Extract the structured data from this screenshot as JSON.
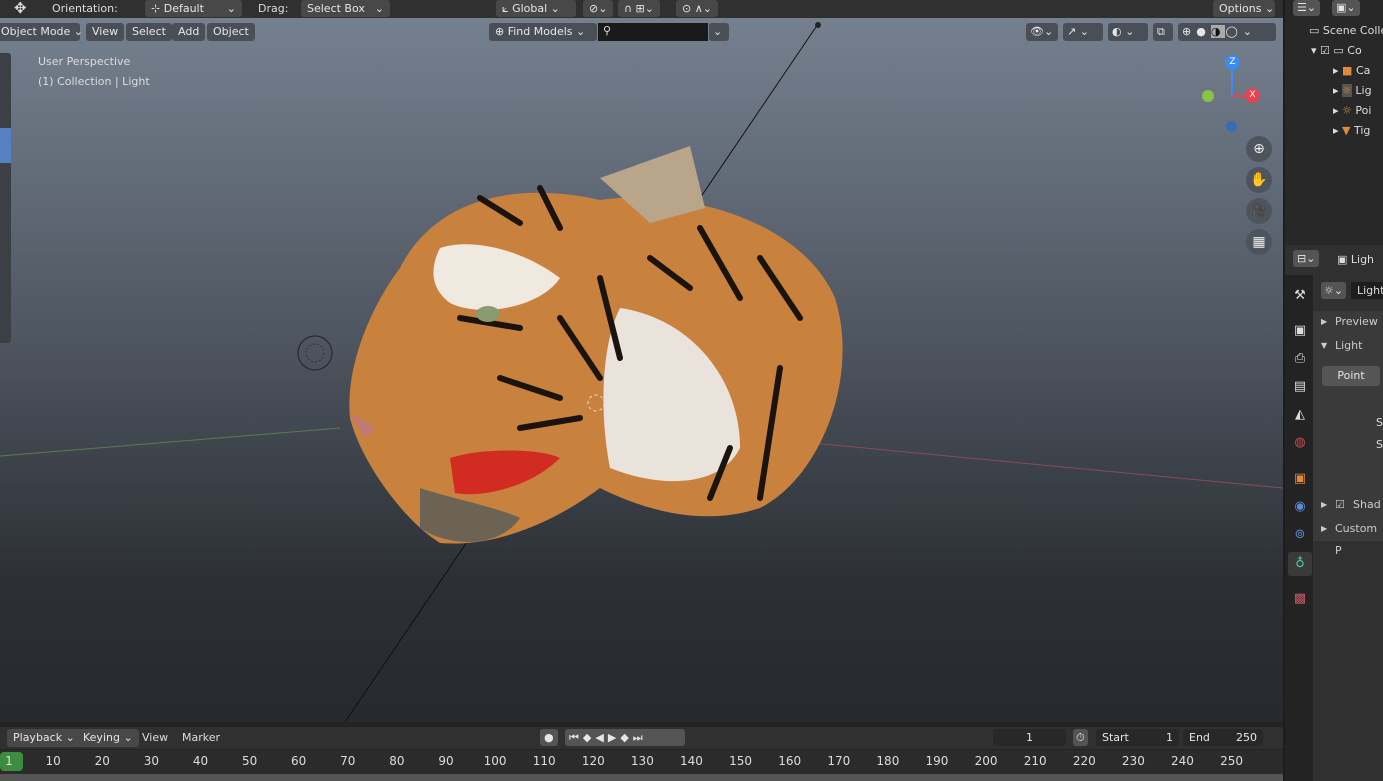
{
  "header": {
    "orientation_label": "Orientation:",
    "orientation_value": "Default",
    "drag_label": "Drag:",
    "drag_value": "Select Box",
    "transform_space": "Global",
    "options": "Options"
  },
  "viewport_header": {
    "mode": "Object Mode",
    "menus": [
      "View",
      "Select",
      "Add",
      "Object"
    ],
    "find_models": "Find Models",
    "search_placeholder": ""
  },
  "viewport": {
    "perspective": "User Perspective",
    "collection": "(1) Collection | Light",
    "gizmo": {
      "z": "Z",
      "x": "X"
    }
  },
  "outliner": {
    "items": [
      {
        "label": "Scene Colle"
      },
      {
        "label": "Co"
      },
      {
        "label": "Ca"
      },
      {
        "label": "Lig"
      },
      {
        "label": "Poi"
      },
      {
        "label": "Tig"
      }
    ]
  },
  "properties": {
    "header": "Ligh",
    "datablock": "Light",
    "panels": {
      "preview": "Preview",
      "light": "Light",
      "type": "Point",
      "s1": "S",
      "s2": "S",
      "shadow": "Shad",
      "custom": "Custom P"
    }
  },
  "timeline": {
    "menus": [
      "Playback",
      "Keying",
      "View",
      "Marker"
    ],
    "current_frame": "1",
    "start_label": "Start",
    "start": "1",
    "end_label": "End",
    "end": "250",
    "ticks": [
      "1",
      "10",
      "20",
      "30",
      "40",
      "50",
      "60",
      "70",
      "80",
      "90",
      "100",
      "110",
      "120",
      "130",
      "140",
      "150",
      "160",
      "170",
      "180",
      "190",
      "200",
      "210",
      "220",
      "230",
      "240",
      "250"
    ]
  },
  "colors": {
    "accent": "#4772b3",
    "frame": "#3d8c40",
    "x_axis": "#e8424f",
    "y_axis": "#8bc34a",
    "z_axis": "#3a8cf0"
  }
}
